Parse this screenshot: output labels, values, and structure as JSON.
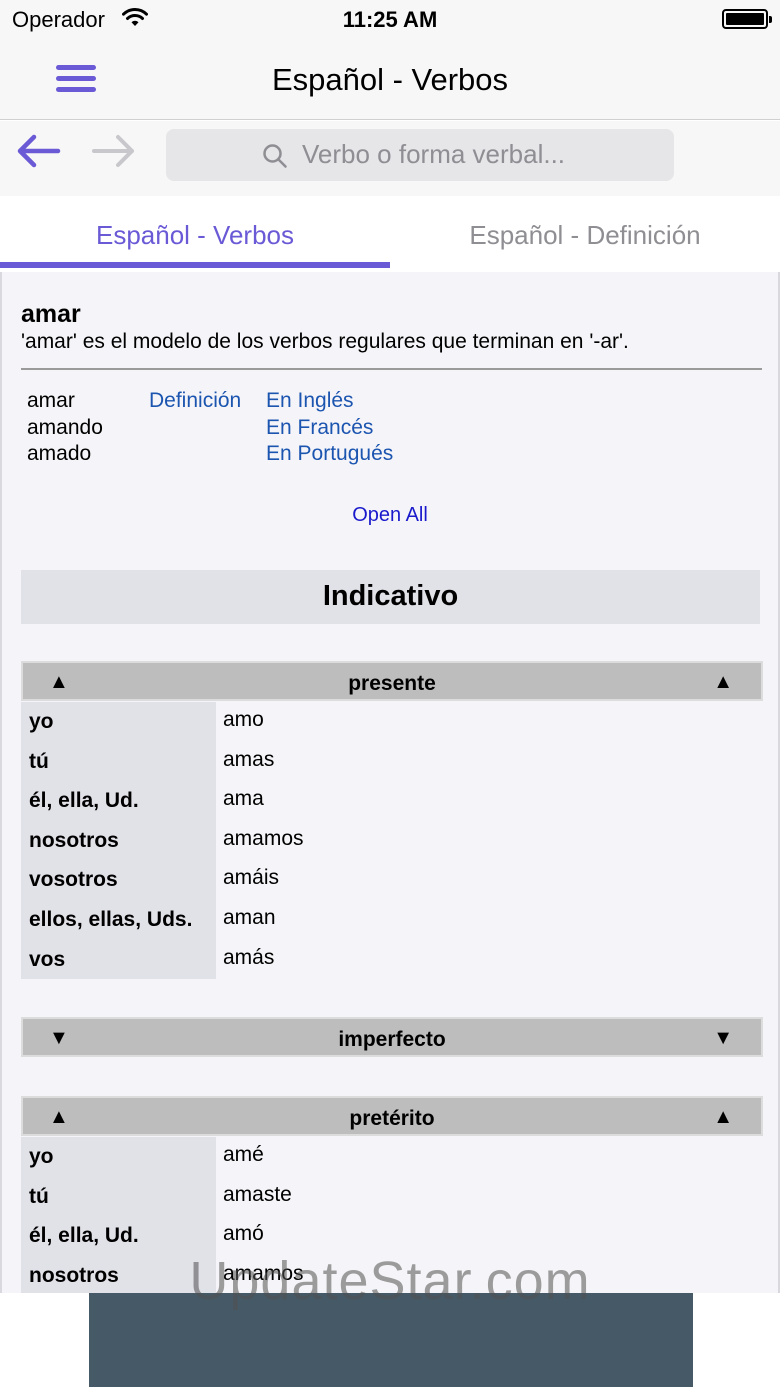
{
  "status_bar": {
    "carrier": "Operador",
    "time": "11:25 AM"
  },
  "nav": {
    "title": "Español - Verbos"
  },
  "search": {
    "placeholder": "Verbo o forma verbal..."
  },
  "tabs": [
    {
      "label": "Español - Verbos",
      "active": true
    },
    {
      "label": "Español - Definición",
      "active": false
    }
  ],
  "verb": {
    "title": "amar",
    "description": "'amar' es el modelo de los verbos regulares que terminan en '-ar'.",
    "forms": [
      "amar",
      "amando",
      "amado"
    ],
    "definition_link": "Definición",
    "translation_links": [
      "En Inglés",
      "En Francés",
      "En Portugués"
    ],
    "open_all": "Open All"
  },
  "mood": "Indicativo",
  "tenses": [
    {
      "name": "presente",
      "expanded": true,
      "arrow": "▲",
      "rows": [
        {
          "pronoun": "yo",
          "form": "amo"
        },
        {
          "pronoun": "tú",
          "form": "amas"
        },
        {
          "pronoun": "él, ella, Ud.",
          "form": "ama"
        },
        {
          "pronoun": "nosotros",
          "form": "amamos"
        },
        {
          "pronoun": "vosotros",
          "form": "amáis"
        },
        {
          "pronoun": "ellos, ellas, Uds.",
          "form": "aman"
        },
        {
          "pronoun": "vos",
          "form": "amás"
        }
      ]
    },
    {
      "name": "imperfecto",
      "expanded": false,
      "arrow": "▼",
      "rows": []
    },
    {
      "name": "pretérito",
      "expanded": true,
      "arrow": "▲",
      "rows": [
        {
          "pronoun": "yo",
          "form": "amé"
        },
        {
          "pronoun": "tú",
          "form": "amaste"
        },
        {
          "pronoun": "él, ella, Ud.",
          "form": "amó"
        },
        {
          "pronoun": "nosotros",
          "form": "amamos"
        }
      ]
    }
  ],
  "watermark": "UpdateStar.com",
  "colors": {
    "accent": "#6a5ad6",
    "link": "#1c55b0",
    "open_all": "#1a1acc",
    "header_bg": "#bdbdbd",
    "pronoun_bg": "#e1e1e8",
    "ad_banner": "#455a66"
  }
}
